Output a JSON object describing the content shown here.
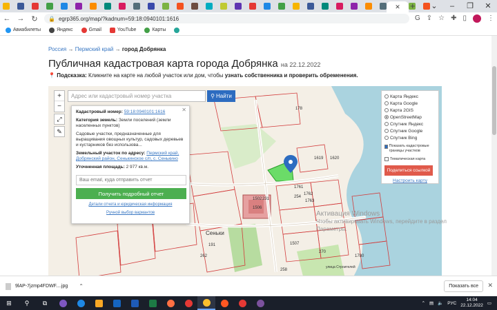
{
  "browser": {
    "url": "egrp365.org/map/?kadnum=59:18:0940101:1616",
    "tab_close": "✕",
    "new_tab": "+",
    "favicon_colors": [
      "#f7b500",
      "#3b5998",
      "#e53935",
      "#43a047",
      "#1e88e5",
      "#8e24aa",
      "#fb8c00",
      "#00897b",
      "#d81b60",
      "#546e7a",
      "#3949ab",
      "#7cb342",
      "#f4511e",
      "#6d4c41",
      "#00acc1",
      "#c0ca33",
      "#5e35b1",
      "#e53935",
      "#1e88e5",
      "#43a047",
      "#f7b500",
      "#3b5998",
      "#00897b",
      "#d81b60",
      "#8e24aa",
      "#fb8c00",
      "#546e7a",
      "#3949ab",
      "#7cb342",
      "#f4511e"
    ]
  },
  "bookmarks": [
    {
      "label": "Авиабилеты",
      "color": "#2196f3"
    },
    {
      "label": "Яндекс",
      "color": "#444"
    },
    {
      "label": "Gmail",
      "color": "#e53935"
    },
    {
      "label": "YouTube",
      "color": "#e53935"
    },
    {
      "label": "Карты",
      "color": "#43a047"
    },
    {
      "label": "",
      "color": "#26a69a"
    }
  ],
  "page": {
    "breadcrumb": {
      "root": "Россия",
      "region": "Пермский край",
      "current": "город Добрянка"
    },
    "title": "Публичная кадастровая карта города Добрянка",
    "date": "на 22.12.2022",
    "hint_label": "Подсказка:",
    "hint_text": "Кликните на карте на любой участок или дом, чтобы",
    "hint_bold": "узнать собственника и проверить обременения."
  },
  "map": {
    "search_placeholder": "Адрес или кадастровый номер участка",
    "search_button": "Найти",
    "zoom_in": "+",
    "zoom_out": "−",
    "labels": [
      "178",
      "1619",
      "1620",
      "1761",
      "1762",
      "1763",
      "254",
      "1502",
      "231",
      "1506",
      "191",
      "262",
      "1780",
      "270",
      "258",
      "1507",
      "Сеньки",
      "улица Строителей"
    ]
  },
  "popup": {
    "cad_label": "Кадастровый номер:",
    "cad_value": "59:18:0940101:1616",
    "cat_label": "Категория земель:",
    "cat_value": "Земли поселений (земли населенных пунктов)",
    "use_text": "Садовые участки, предназначенные для выращивания овощных культур, садовых деревьев и кустарников без использова...",
    "addr_label": "Земельный участок по адресу:",
    "addr_value": "Пермский край, Добрянский район, Сенькинское с/п, с. Сенькино",
    "area_label": "Уточненная площадь:",
    "area_value": "2 977 кв.м.",
    "email_placeholder": "Ваш email, куда отправить отчет",
    "get_report": "Получить подробный отчет",
    "details_link": "Детали отчета и юридическая информация",
    "manual_link": "Ручной выбор вариантов"
  },
  "layers": {
    "options": [
      {
        "label": "Карта Яндекс",
        "selected": false
      },
      {
        "label": "Карта Google",
        "selected": false
      },
      {
        "label": "Карта 2GIS",
        "selected": false
      },
      {
        "label": "OpenStreetMap",
        "selected": true
      },
      {
        "label": "Спутник Яндекс",
        "selected": false
      },
      {
        "label": "Спутник Google",
        "selected": false
      },
      {
        "label": "Спутник Bing",
        "selected": false
      }
    ],
    "show_borders": "Показать кадастровые границы участков",
    "thematic": "Тематическая карта",
    "share_button": "Поделиться ссылкой",
    "setup_link": "Настроить карту"
  },
  "watermark": {
    "line1": "Активация Windows",
    "line2": "Чтобы активировать Windows, перейдите в раздел",
    "line3": "Параметры."
  },
  "download": {
    "filename": "9lAP-7jzmp4FDWF....jpg",
    "show_all": "Показать все"
  },
  "taskbar": {
    "lang": "РУС",
    "time": "14:04",
    "date": "22.12.2022"
  }
}
